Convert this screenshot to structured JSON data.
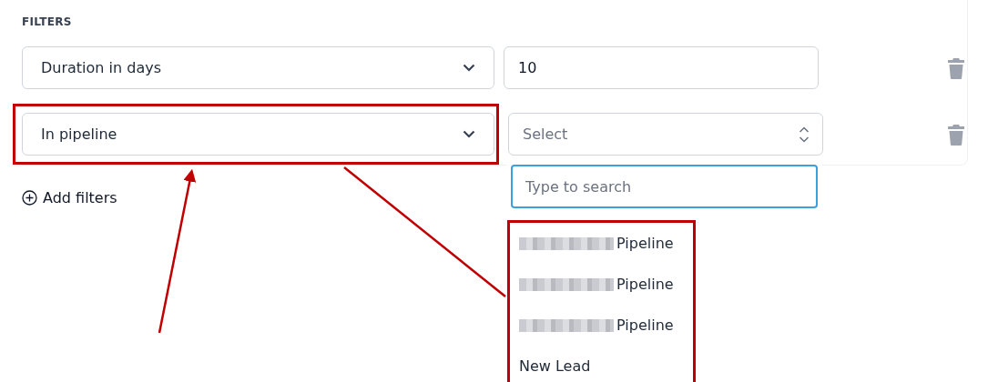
{
  "section_title": "FILTERS",
  "filters": [
    {
      "field": "Duration in days",
      "value": "10",
      "kind": "input",
      "highlighted": false
    },
    {
      "field": "In pipeline",
      "placeholder": "Select",
      "kind": "select",
      "highlighted": true
    }
  ],
  "add_button": "Add filters",
  "dropdown": {
    "search_placeholder": "Type to search",
    "options_highlighted": true,
    "options": [
      {
        "label": "Pipeline",
        "redacted": true
      },
      {
        "label": "Pipeline",
        "redacted": true
      },
      {
        "label": "Pipeline",
        "redacted": true
      },
      {
        "label": "New Lead",
        "redacted": false
      }
    ]
  },
  "annotations": [
    {
      "kind": "arrow"
    },
    {
      "kind": "line"
    }
  ]
}
